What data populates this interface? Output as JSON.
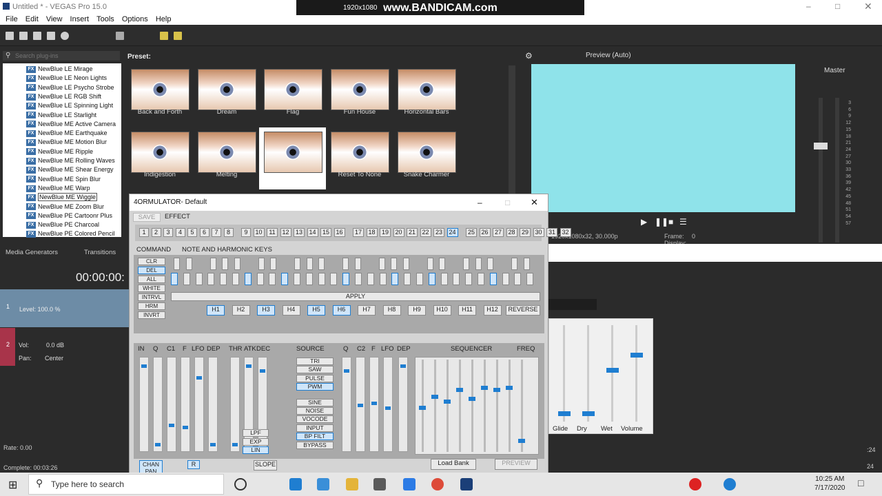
{
  "window": {
    "title": "Untitled * - VEGAS Pro 15.0"
  },
  "menu": [
    "File",
    "Edit",
    "View",
    "Insert",
    "Tools",
    "Options",
    "Help"
  ],
  "recorder": {
    "brand": "www.BANDICAM.com",
    "resolution": "1920x1080"
  },
  "plugins": {
    "search_placeholder": "Search plug-ins",
    "items": [
      "NewBlue LE Mirage",
      "NewBlue LE Neon Lights",
      "NewBlue LE Psycho Strobe",
      "NewBlue LE RGB Shift",
      "NewBlue LE Spinning Light",
      "NewBlue LE Starlight",
      "NewBlue ME Active Camera",
      "NewBlue ME Earthquake",
      "NewBlue ME Motion Blur",
      "NewBlue ME Ripple",
      "NewBlue ME Rolling Waves",
      "NewBlue ME Shear Energy",
      "NewBlue ME Spin Blur",
      "NewBlue ME Warp",
      "NewBlue ME Wiggle",
      "NewBlue ME Zoom Blur",
      "NewBlue PE Cartoonr Plus",
      "NewBlue PE Charcoal",
      "NewBlue PE Colored Pencil"
    ],
    "selected_index": 14,
    "icon_label": "FX"
  },
  "preset": {
    "label": "Preset:",
    "items": [
      "Back and Forth",
      "Dream",
      "Flag",
      "Fun House",
      "Horizontal Bars",
      "Indigestion",
      "Melting",
      "",
      "Reset To None",
      "Snake Charmer"
    ]
  },
  "preview": {
    "mode": "Preview (Auto)",
    "info1": "1920x1080x32, 30.000p",
    "frame_label": "Frame:",
    "frame_value": "0",
    "display_label": "Display:"
  },
  "master": {
    "label": "Master",
    "scale": [
      "3",
      "6",
      "9",
      "12",
      "15",
      "18",
      "21",
      "24",
      "27",
      "30",
      "33",
      "36",
      "39",
      "42",
      "45",
      "48",
      "51",
      "54",
      "57"
    ]
  },
  "tabs": {
    "media_generators": "Media Generators",
    "transitions": "Transitions"
  },
  "timeline": {
    "time": "00:00:00:",
    "level": "Level: 100.0 %",
    "vol_label": "Vol:",
    "vol_value": "0.0 dB",
    "pan_label": "Pan:",
    "pan_value": "Center",
    "rate": "Rate: 0.00",
    "complete": "Complete: 00:03:26",
    "track1": "1",
    "track2": "2"
  },
  "mixer": {
    "labels": [
      "Glide",
      "Dry",
      "Wet",
      "Volume"
    ],
    "levels": [
      0.05,
      0.05,
      0.62,
      0.82
    ],
    "side_value": ":24",
    "side_value2": "24"
  },
  "plugin_window": {
    "title": "4ORMULATOR- Default",
    "save": "SAVE",
    "effect": "EFFECT",
    "numbers": [
      "1",
      "2",
      "3",
      "4",
      "5",
      "6",
      "7",
      "8",
      "9",
      "10",
      "11",
      "12",
      "13",
      "14",
      "15",
      "16",
      "17",
      "18",
      "19",
      "20",
      "21",
      "22",
      "23",
      "24",
      "25",
      "26",
      "27",
      "28",
      "29",
      "30",
      "31",
      "32"
    ],
    "selected_number": "24",
    "command_label": "COMMAND",
    "keys_label": "NOTE AND HARMONIC KEYS",
    "commands": [
      "CLR",
      "DEL",
      "ALL",
      "WHITE",
      "INTRVL",
      "HRM",
      "INVRT"
    ],
    "apply": "APPLY",
    "harmonics": [
      "H1",
      "H2",
      "H3",
      "H4",
      "H5",
      "H6",
      "H7",
      "H8",
      "H9",
      "H10",
      "H11",
      "H12"
    ],
    "harmonics_on": [
      "H1",
      "H3",
      "H5",
      "H6"
    ],
    "reverse": "REVERSE",
    "left_labels": [
      "IN",
      "Q",
      "C1",
      "F",
      "LFO",
      "DEP"
    ],
    "env_labels": [
      "THR",
      "ATK",
      "DEC"
    ],
    "source_label": "SOURCE",
    "mid_labels": [
      "Q",
      "C2",
      "F",
      "LFO",
      "DEP"
    ],
    "sequencer": "SEQUENCER",
    "freq": "FREQ",
    "sources": [
      "TRI",
      "SAW",
      "PULSE",
      "PWM",
      "SINE",
      "NOISE",
      "VOCODE",
      "INPUT",
      "BP FILT",
      "BYPASS"
    ],
    "source_selected": [
      "PWM",
      "BP FILT"
    ],
    "filters": [
      "LPF",
      "EXP",
      "LIN"
    ],
    "chan": "CHAN PAN",
    "r": "R",
    "slope": "SLOPE",
    "load_bank": "Load Bank",
    "preview": "PREVIEW"
  },
  "taskbar": {
    "search": "Type here to search",
    "time": "10:25 AM",
    "date": "7/17/2020"
  }
}
